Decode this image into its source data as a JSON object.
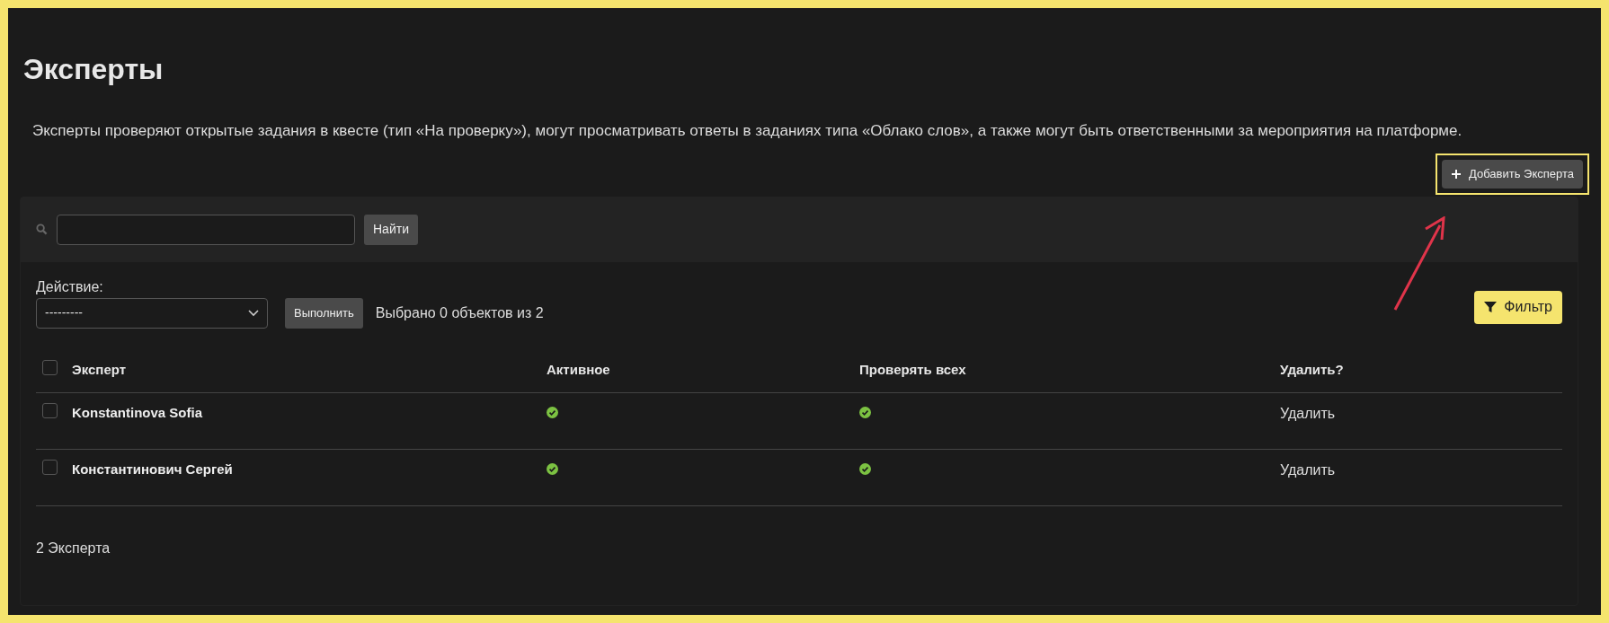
{
  "title": "Эксперты",
  "description": "Эксперты проверяют открытые задания в квесте (тип «На проверку»), могут просматривать ответы в заданиях типа «Облако слов», а также могут быть ответственными за мероприятия на платформе.",
  "add_button": {
    "label": "Добавить Эксперта",
    "highlighted": true
  },
  "search": {
    "button": "Найти"
  },
  "actions": {
    "label": "Действие:",
    "select_value": "---------",
    "run_button": "Выполнить",
    "selection_count": "Выбрано 0 объектов из 2"
  },
  "filter_button": "Фильтр",
  "table": {
    "columns": [
      "Эксперт",
      "Активное",
      "Проверять всех",
      "Удалить?"
    ],
    "select_all_checked": false,
    "rows": [
      {
        "checked": false,
        "name": "Konstantinova Sofia",
        "active": true,
        "check_all": true,
        "delete": "Удалить"
      },
      {
        "checked": false,
        "name": "Константинович Сергей",
        "active": true,
        "check_all": true,
        "delete": "Удалить"
      }
    ]
  },
  "footer": "2 Эксперта"
}
